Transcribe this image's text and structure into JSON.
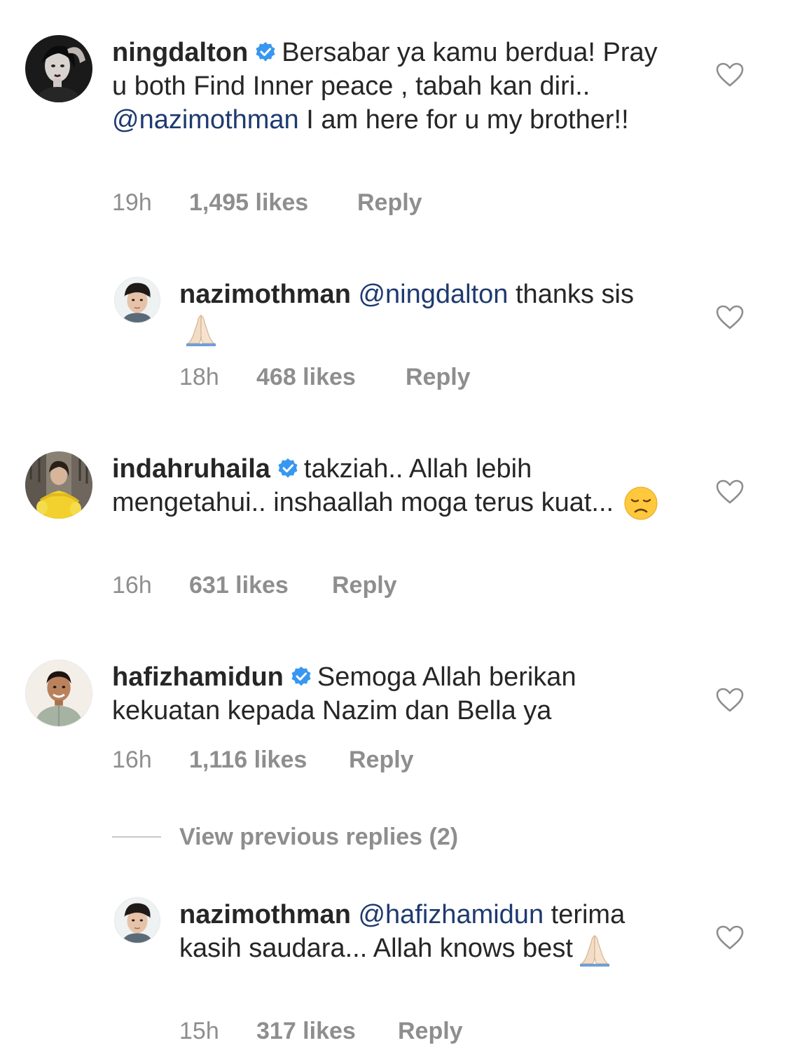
{
  "colors": {
    "text": "#262626",
    "muted": "#8e8e8e",
    "mention": "#1e3a70",
    "verified": "#3897f0"
  },
  "icons": {
    "verified": "verified-badge-icon",
    "like": "heart-outline-icon",
    "pray": "folded-hands-emoji",
    "sad": "disappointed-face-emoji"
  },
  "comments": [
    {
      "username": "ningdalton",
      "verified": true,
      "text": "Bersabar ya kamu berdua! Pray u both Find Inner peace , tabah kan diri..",
      "mention": "@nazimothman",
      "text_after": "I am here for u my brother!!",
      "time": "19h",
      "likes": "1,495 likes",
      "reply_label": "Reply"
    },
    {
      "username": "nazimothman",
      "mention": "@ningdalton",
      "text_after": "thanks sis",
      "time": "18h",
      "likes": "468 likes",
      "reply_label": "Reply"
    },
    {
      "username": "indahruhaila",
      "verified": true,
      "text": "takziah.. Allah lebih mengetahui.. inshaallah moga terus kuat...",
      "time": "16h",
      "likes": "631 likes",
      "reply_label": "Reply"
    },
    {
      "username": "hafizhamidun",
      "verified": true,
      "text": "Semoga Allah berikan kekuatan kepada Nazim dan Bella ya",
      "time": "16h",
      "likes": "1,116 likes",
      "reply_label": "Reply"
    },
    {
      "username": "nazimothman",
      "mention": "@hafizhamidun",
      "text_after": "terima kasih saudara... Allah knows best",
      "time": "15h",
      "likes": "317 likes",
      "reply_label": "Reply"
    }
  ],
  "view_previous_replies": "View previous replies (2)"
}
